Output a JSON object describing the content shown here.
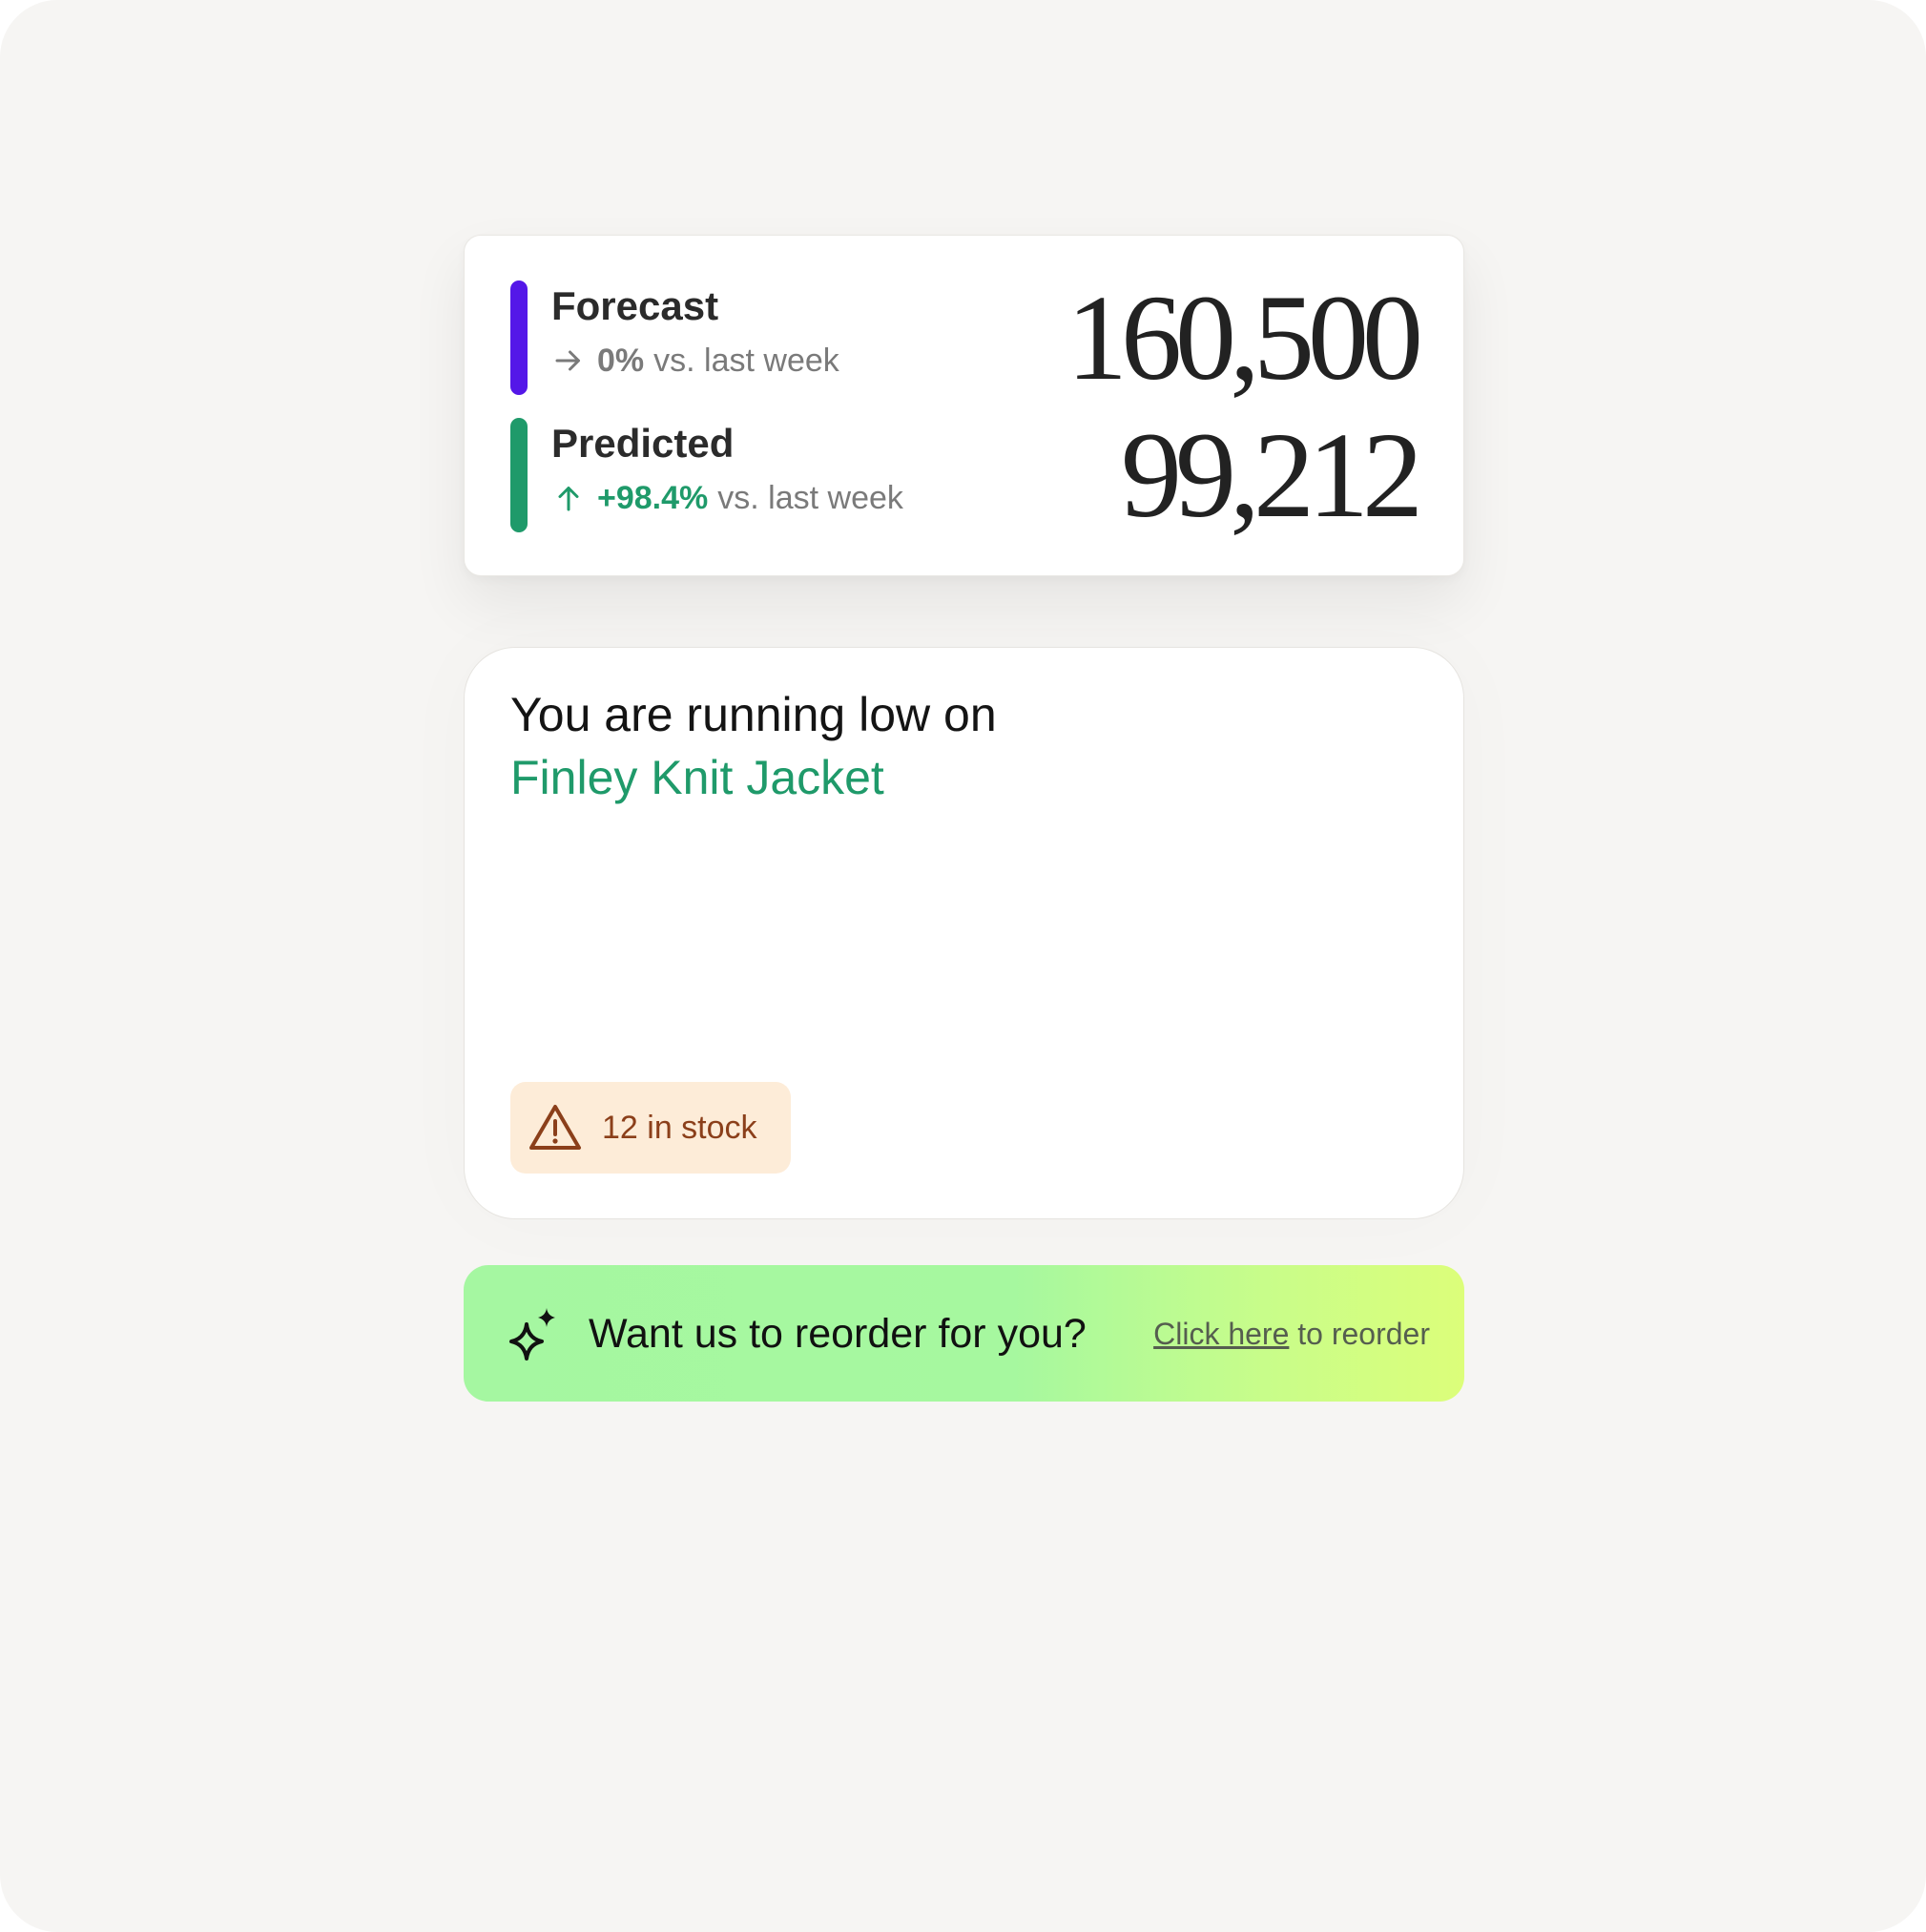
{
  "metrics": [
    {
      "label": "Forecast",
      "delta_icon": "arrow-right-icon",
      "delta_value": "0%",
      "delta_suffix": "vs. last week",
      "value": "160,500",
      "bar_color": "#5417e8",
      "delta_color": "#7a7a7a"
    },
    {
      "label": "Predicted",
      "delta_icon": "arrow-up-icon",
      "delta_value": "+98.4%",
      "delta_suffix": "vs. last week",
      "value": "99,212",
      "bar_color": "#1f9a6a",
      "delta_color": "#1f9a6a"
    }
  ],
  "low_stock": {
    "title": "You are running low on",
    "product": "Finley Knit Jacket",
    "badge_icon": "warning-triangle-icon",
    "badge_text": "12 in stock"
  },
  "reorder": {
    "icon": "sparkle-icon",
    "question": "Want us to reorder for you?",
    "link_text": "Click here",
    "link_suffix": " to reorder"
  },
  "colors": {
    "background": "#f6f5f3",
    "accent_purple": "#5417e8",
    "accent_green": "#1f9a6a",
    "badge_bg": "#fdecd8",
    "badge_text": "#8b3f1a"
  }
}
